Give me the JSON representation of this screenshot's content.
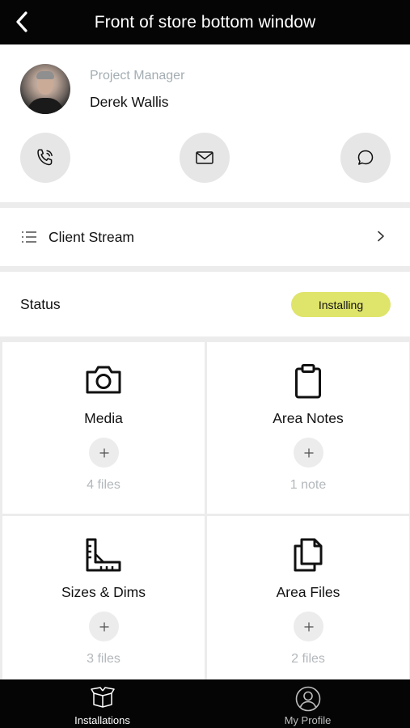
{
  "header": {
    "title": "Front of store bottom window",
    "back_icon": "chevron-left-icon"
  },
  "project_manager": {
    "role": "Project Manager",
    "name": "Derek Wallis",
    "actions": [
      {
        "icon": "phone-icon"
      },
      {
        "icon": "mail-icon"
      },
      {
        "icon": "chat-bubble-icon"
      }
    ]
  },
  "client_stream": {
    "label": "Client Stream",
    "icon": "list-icon",
    "chevron": "chevron-right-icon"
  },
  "status": {
    "label": "Status",
    "value": "Installing",
    "pill_color": "#dfe46a"
  },
  "tiles": [
    {
      "label": "Media",
      "count": "4 files",
      "icon": "camera-icon",
      "add": "+"
    },
    {
      "label": "Area Notes",
      "count": "1 note",
      "icon": "clipboard-icon",
      "add": "+"
    },
    {
      "label": "Sizes & Dims",
      "count": "3 files",
      "icon": "ruler-icon",
      "add": "+"
    },
    {
      "label": "Area Files",
      "count": "2 files",
      "icon": "documents-icon",
      "add": "+"
    }
  ],
  "tabbar": {
    "tabs": [
      {
        "label": "Installations",
        "icon": "box-icon"
      },
      {
        "label": "My Profile",
        "icon": "profile-icon"
      }
    ]
  },
  "colors": {
    "bar_bg": "#050505",
    "page_bg": "#ececec",
    "muted_text": "#a3adb2"
  }
}
